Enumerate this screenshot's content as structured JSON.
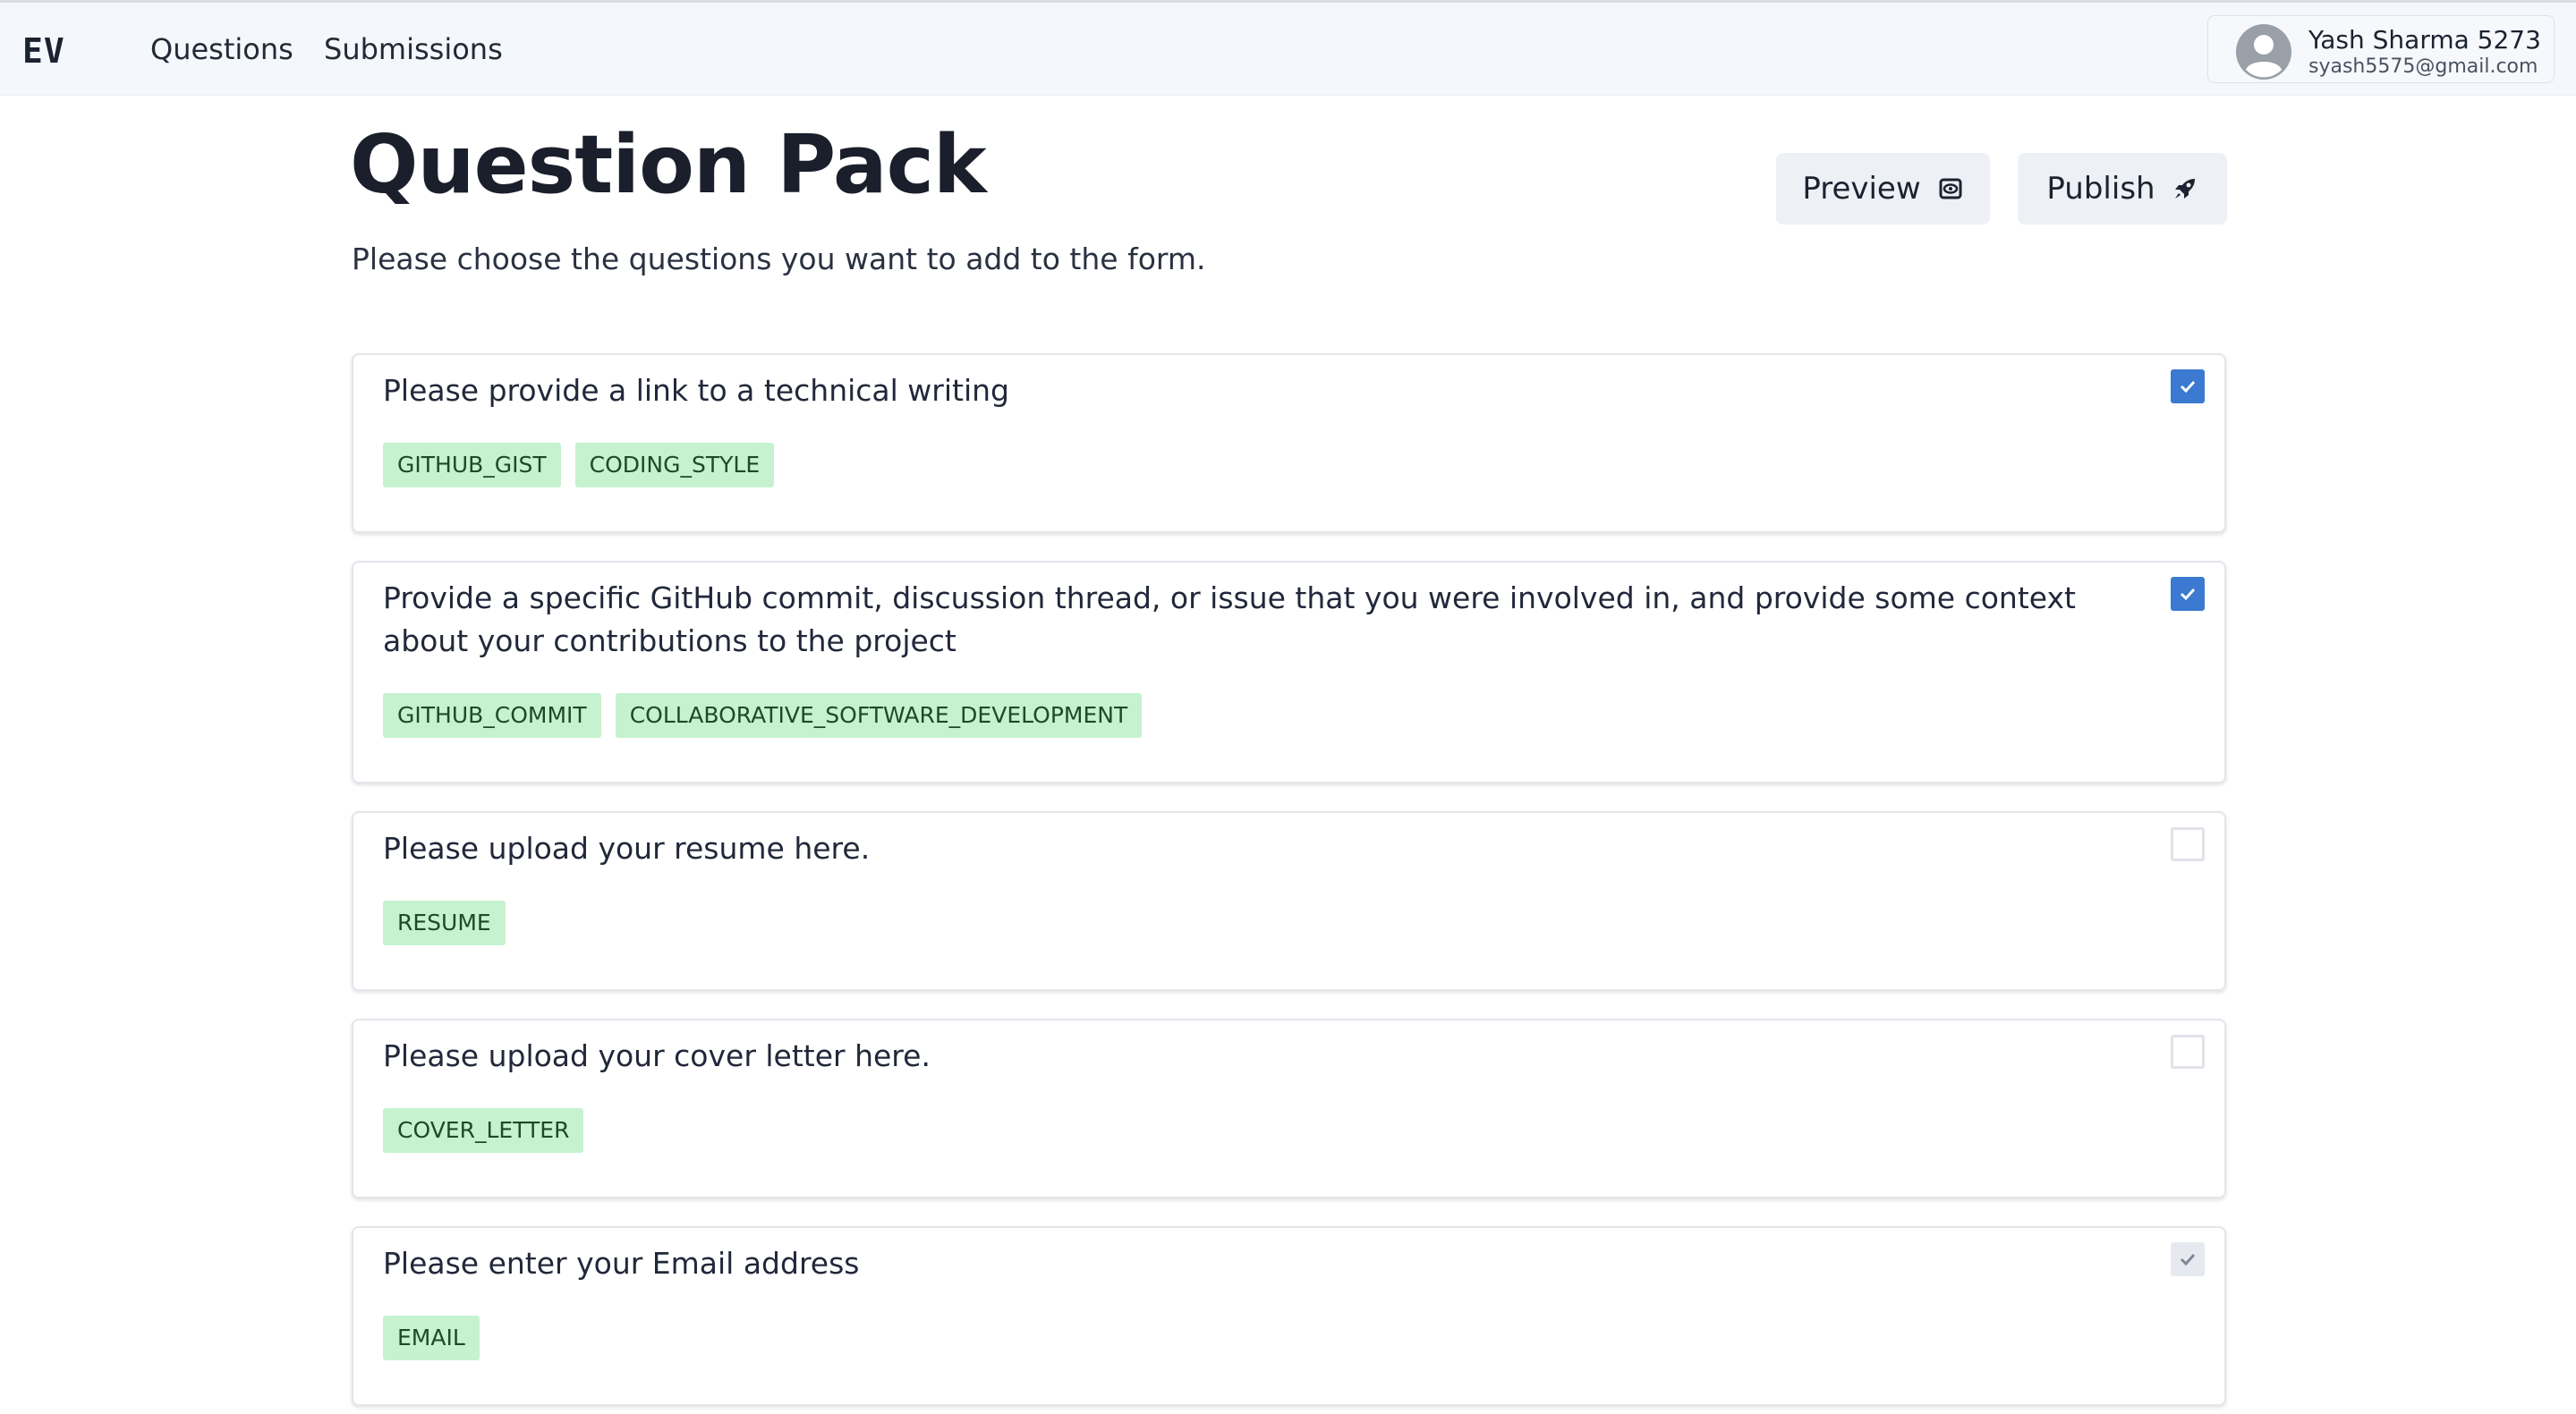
{
  "nav": {
    "logo": "EV",
    "links": [
      "Questions",
      "Submissions"
    ],
    "user": {
      "name": "Yash Sharma 5273",
      "email": "syash5575@gmail.com"
    }
  },
  "page": {
    "title": "Question Pack",
    "subtitle": "Please choose the questions you want to add to the form.",
    "preview_label": "Preview",
    "publish_label": "Publish"
  },
  "questions": [
    {
      "text": "Please provide a link to a technical writing",
      "tags": [
        "GITHUB_GIST",
        "CODING_STYLE"
      ],
      "state": "checked"
    },
    {
      "text": "Provide a specific GitHub commit, discussion thread, or issue that you were involved in, and provide some context about your contributions to the project",
      "tags": [
        "GITHUB_COMMIT",
        "COLLABORATIVE_SOFTWARE_DEVELOPMENT"
      ],
      "state": "checked"
    },
    {
      "text": "Please upload your resume here.",
      "tags": [
        "RESUME"
      ],
      "state": "unchecked"
    },
    {
      "text": "Please upload your cover letter here.",
      "tags": [
        "COVER_LETTER"
      ],
      "state": "unchecked"
    },
    {
      "text": "Please enter your Email address",
      "tags": [
        "EMAIL"
      ],
      "state": "checked-disabled"
    }
  ],
  "colors": {
    "accent": "#3b7ad0",
    "tag_bg": "#c6f2d0",
    "tag_text": "#1f4a2a"
  }
}
